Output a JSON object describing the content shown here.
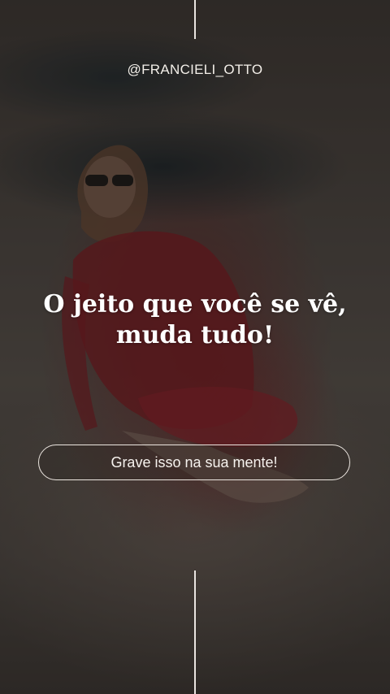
{
  "story": {
    "handle": "@FRANCIELI_OTTO",
    "headline_line1": "O jeito que você se vê,",
    "headline_line2": "muda tudo!",
    "cta_label": "Grave isso na sua mente!"
  },
  "colors": {
    "text": "#ffffff",
    "accent_lines": "#e9e4e0",
    "outfit_red": "#8a1e26",
    "sand": "#56504b"
  }
}
